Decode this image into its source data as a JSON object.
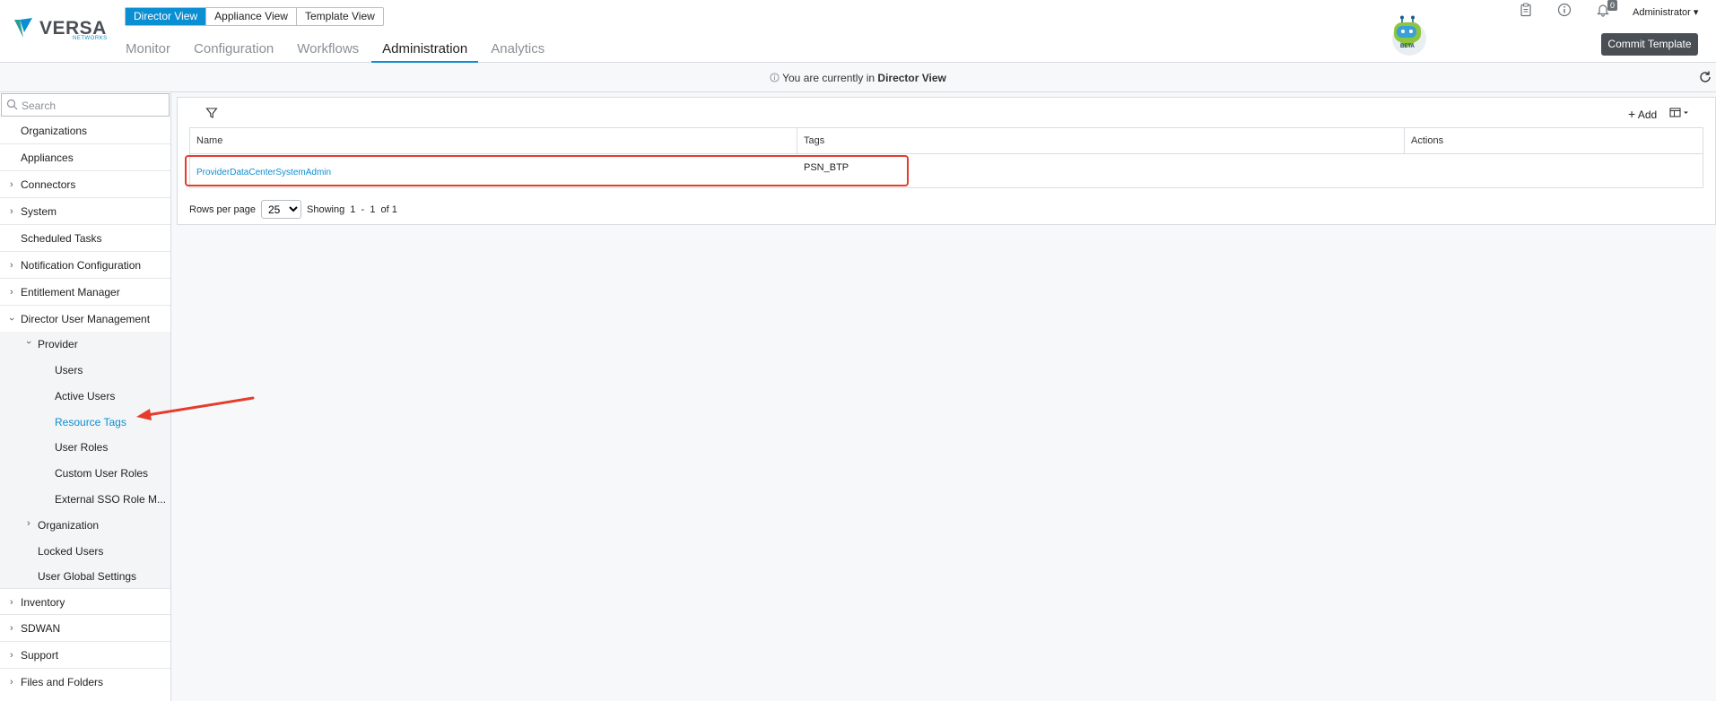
{
  "brand": {
    "name": "VERSA",
    "sub": "NETWORKS"
  },
  "view_switch": [
    "Director View",
    "Appliance View",
    "Template View"
  ],
  "main_nav": [
    "Monitor",
    "Configuration",
    "Workflows",
    "Administration",
    "Analytics"
  ],
  "active_nav": "Administration",
  "header": {
    "bot_label": "BETA",
    "notification_count": "0",
    "user": "Administrator",
    "commit_label": "Commit Template",
    "icons": [
      "clipboard-icon",
      "info-icon",
      "bell-icon"
    ]
  },
  "banner": {
    "prefix": "You are currently in ",
    "view": "Director View"
  },
  "sidebar": {
    "search_placeholder": "Search",
    "top_items": [
      {
        "label": "Organizations",
        "expandable": false
      },
      {
        "label": "Appliances",
        "expandable": false
      },
      {
        "label": "Connectors",
        "expandable": true
      },
      {
        "label": "System",
        "expandable": true
      },
      {
        "label": "Scheduled Tasks",
        "expandable": false
      },
      {
        "label": "Notification Configuration",
        "expandable": true
      },
      {
        "label": "Entitlement Manager",
        "expandable": true
      },
      {
        "label": "Director User Management",
        "expandable": true,
        "expanded": true
      }
    ],
    "dum_children": {
      "provider": "Provider",
      "provider_items": [
        "Users",
        "Active Users",
        "Resource Tags",
        "User Roles",
        "Custom User Roles",
        "External SSO Role M..."
      ],
      "selected": "Resource Tags",
      "organization": "Organization",
      "locked_users": "Locked Users",
      "user_global_settings": "User Global Settings"
    },
    "bottom_items": [
      {
        "label": "Inventory",
        "expandable": true
      },
      {
        "label": "SDWAN",
        "expandable": true
      },
      {
        "label": "Support",
        "expandable": true
      },
      {
        "label": "Files and Folders",
        "expandable": true
      }
    ]
  },
  "toolbar": {
    "add_label": "Add"
  },
  "table": {
    "columns": [
      "Name",
      "Tags",
      "Actions"
    ],
    "rows": [
      {
        "name": "ProviderDataCenterSystemAdmin",
        "tags": "PSN_BTP",
        "actions": ""
      }
    ]
  },
  "pagination": {
    "rows_per_page_label": "Rows per page",
    "rows_per_page": "25",
    "showing_text": "Showing  1  -  1  of 1"
  },
  "colors": {
    "accent": "#0b8fd3",
    "highlight": "#e53c2c",
    "commit_bg": "#4a4f55"
  }
}
